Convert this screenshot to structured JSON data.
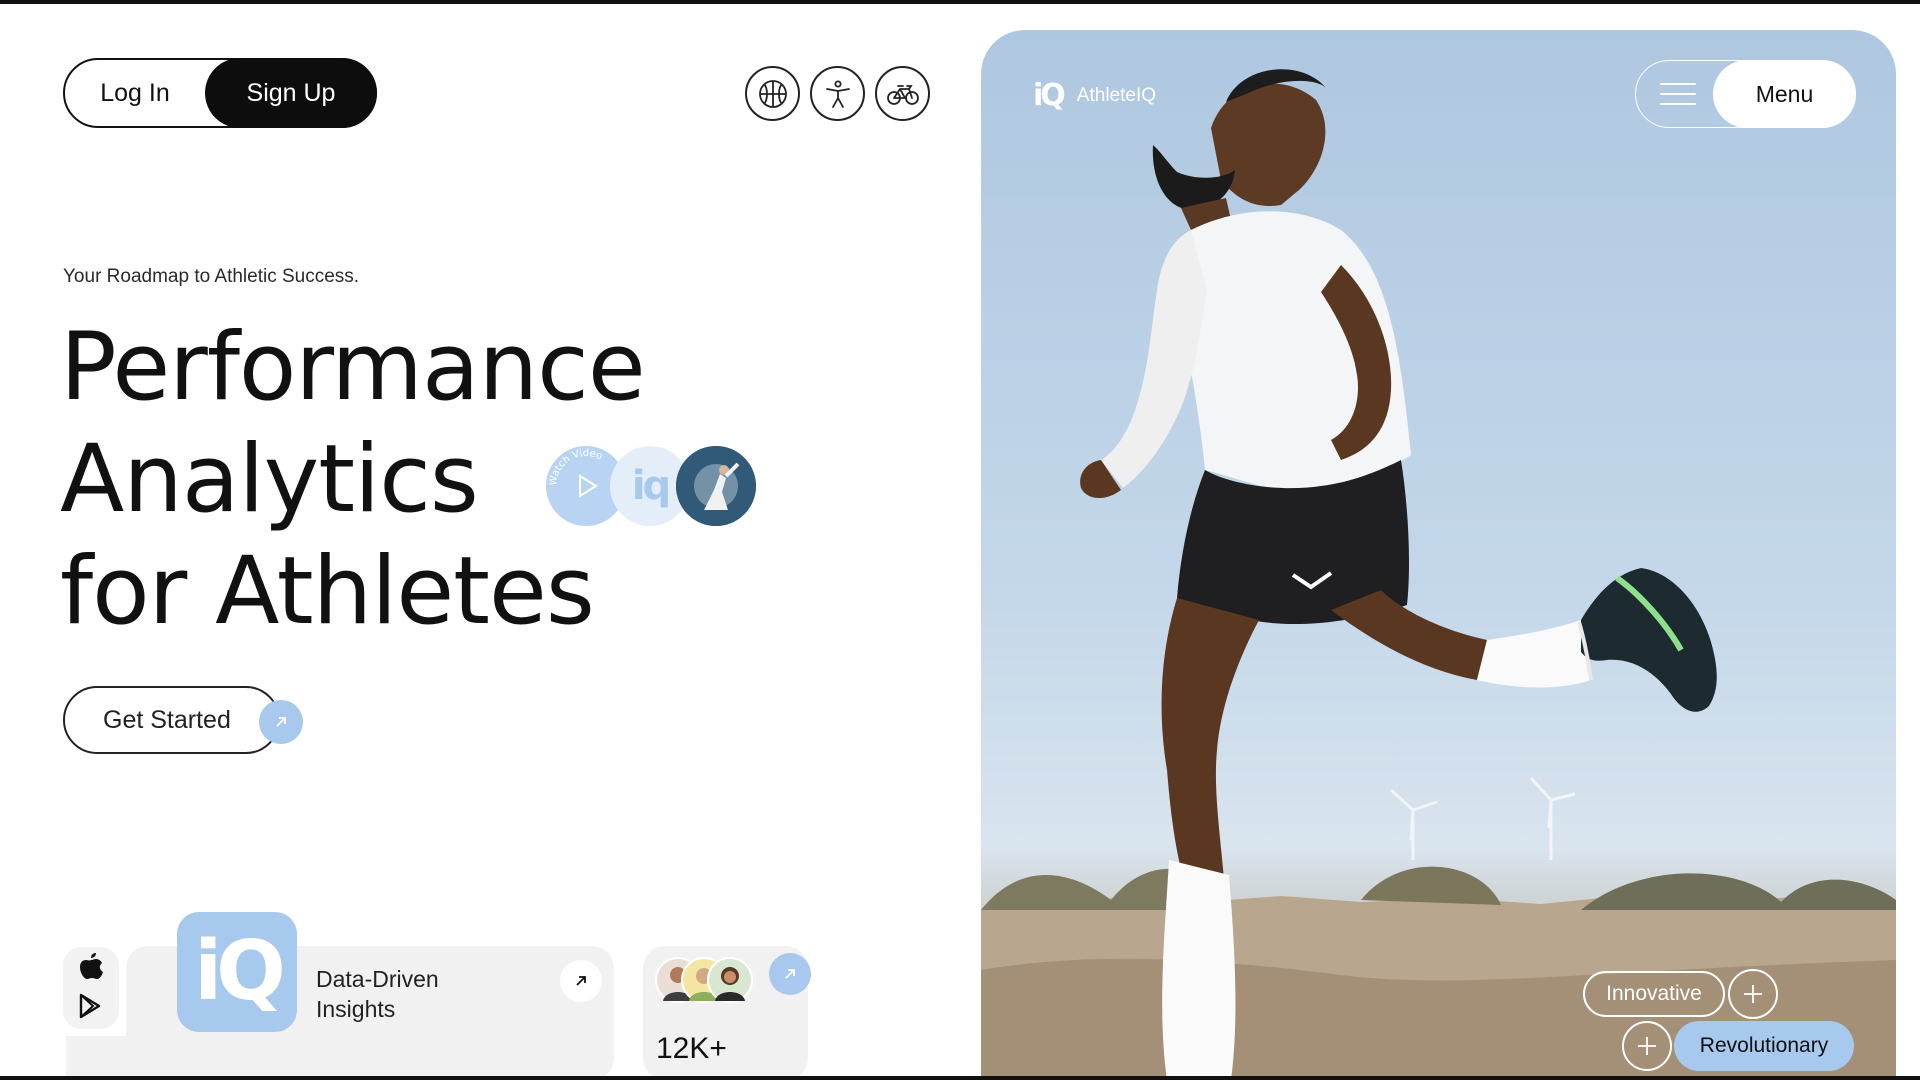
{
  "auth": {
    "login_label": "Log In",
    "signup_label": "Sign Up"
  },
  "sports": [
    "basketball-icon",
    "accessibility-icon",
    "bicycle-icon"
  ],
  "hero_text": {
    "tagline": "Your Roadmap to Athletic Success.",
    "headline": [
      "Performance",
      "Analytics",
      "for Athletes"
    ],
    "bubble_ring_text": "Watch Video",
    "cta_label": "Get Started"
  },
  "cards": {
    "stores": [
      "apple-icon",
      "google-play-icon"
    ],
    "insight_logo": "iQ",
    "insight_text": [
      "Data-Driven",
      "Insights"
    ],
    "stats_value": "12K+"
  },
  "hero_panel": {
    "brand_logo": "iQ",
    "brand_name": "AthleteIQ",
    "menu_label": "Menu",
    "tags": [
      "Innovative",
      "Revolutionary"
    ]
  },
  "colors": {
    "accent": "#a8c9ee",
    "dark": "#0d0d0d",
    "card": "#f1f1f1"
  }
}
